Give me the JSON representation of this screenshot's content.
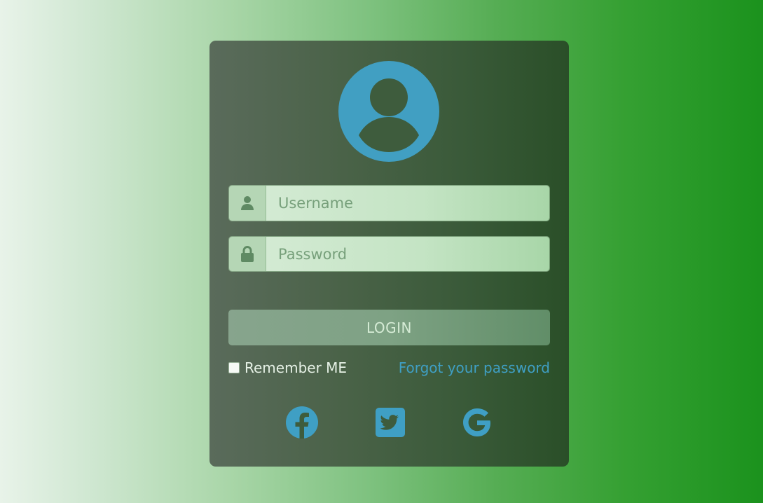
{
  "login": {
    "username_placeholder": "Username",
    "password_placeholder": "Password",
    "login_label": "LOGIN",
    "remember_label": "Remember ME",
    "forgot_label": "Forgot your password"
  },
  "social": {
    "facebook_icon": "facebook-icon",
    "twitter_icon": "twitter-icon",
    "google_icon": "google-icon"
  },
  "colors": {
    "accent": "#419fc2",
    "card_bg": "#3f5c3e",
    "page_gradient_end": "#1b921d"
  }
}
